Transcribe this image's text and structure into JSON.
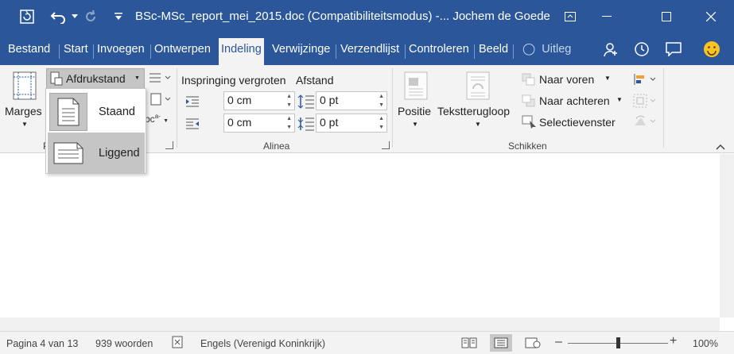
{
  "title": "BSc-MSc_report_mei_2015.doc (Compatibiliteitsmodus)  -... Jochem de Goede",
  "tabs": [
    "Bestand",
    "Start",
    "Invoegen",
    "Ontwerpen",
    "Indeling",
    "Verwijzinge",
    "Verzendlijst",
    "Controleren",
    "Beeld"
  ],
  "tell_me": "Uitleg",
  "ribbon": {
    "margins": "Marges",
    "orientation_btn": "Afdrukstand",
    "indent_header": "Inspringing vergroten",
    "spacing_header": "Afstand",
    "indent_left": "0 cm",
    "indent_right": "0 cm",
    "spacing_before": "0 pt",
    "spacing_after": "0 pt",
    "paragraph_group": "Alinea",
    "position": "Positie",
    "wrap_text": "Tekstterugloop",
    "bring_forward": "Naar voren",
    "send_backward": "Naar achteren",
    "selection_pane": "Selectievenster",
    "arrange_group": "Schikken",
    "page_setup_group_fragment": "P"
  },
  "orientation_menu": {
    "portrait": "Staand",
    "landscape": "Liggend"
  },
  "status": {
    "page": "Pagina 4 van 13",
    "words": "939 woorden",
    "language": "Engels (Verenigd Koninkrijk)",
    "zoom": "100%",
    "zoom_level": 0.5
  },
  "colors": {
    "brand": "#2b579a",
    "ribbon_bg": "#f3f3f3",
    "selected_item": "#c5c5c5"
  }
}
